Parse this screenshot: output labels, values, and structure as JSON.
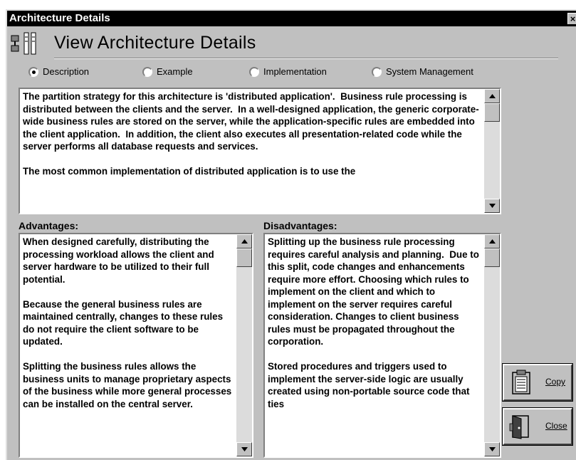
{
  "window": {
    "title": "Architecture Details",
    "close_glyph": "×"
  },
  "header": {
    "title": "View Architecture Details",
    "icon": "architecture-icon"
  },
  "radios": [
    {
      "label": "Description",
      "selected": true
    },
    {
      "label": "Example",
      "selected": false
    },
    {
      "label": "Implementation",
      "selected": false
    },
    {
      "label": "System Management",
      "selected": false
    }
  ],
  "description": {
    "text": "The partition strategy for this architecture is 'distributed application'.  Business rule processing is distributed between the clients and the server.  In a well-designed application, the generic corporate-wide business rules are stored on the server, while the application-specific rules are embedded into the client application.  In addition, the client also executes all presentation-related code while the server performs all database requests and services.\n\nThe most common implementation of distributed application is to use the"
  },
  "advantages": {
    "label": "Advantages:",
    "text": "When designed carefully, distributing the processing workload allows the client and server hardware to be utilized to their full potential.\n\nBecause the general business rules are maintained centrally, changes to these rules do not require the client software to be updated.\n\nSplitting the business rules allows the business units to manage proprietary aspects of the business while more general processes can be installed on the central server."
  },
  "disadvantages": {
    "label": "Disadvantages:",
    "text": "Splitting up the business rule processing requires careful analysis and planning.  Due to this split, code changes and enhancements require more effort. Choosing which rules to implement on the client and which to implement on the server requires careful consideration. Changes to client business rules must be propagated throughout the corporation.\n\nStored procedures and triggers used to implement the server-side logic are usually created using non-portable source code that ties"
  },
  "buttons": {
    "copy_label": "Copy",
    "close_label": "Close"
  }
}
